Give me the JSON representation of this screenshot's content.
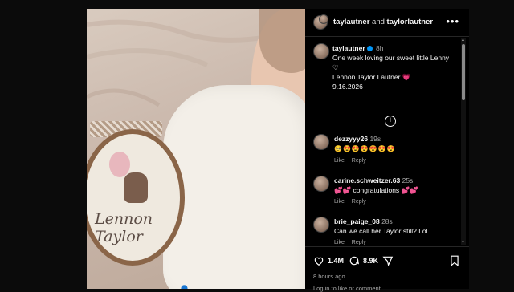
{
  "header": {
    "user1": "taylautner",
    "conjunction": "and",
    "user2": "taylorlautner",
    "more_icon": "more-horizontal-icon"
  },
  "photo": {
    "hoop_text_line1": "Lennon",
    "hoop_text_line2": "Taylor"
  },
  "caption": {
    "username": "taylautner",
    "time": "8h",
    "line1": "One week loving our sweet little Lenny",
    "heart1": "♡",
    "line2": "Lennon Taylor Lautner",
    "heart2": "💗",
    "line3": "9.16.2026"
  },
  "comments": [
    {
      "username": "dezzyyy26",
      "time": "19s",
      "text": "🥺😍😍😍😍😍😍",
      "like": "Like",
      "reply": "Reply"
    },
    {
      "username": "carine.schweitzer.63",
      "time": "25s",
      "text": "💕💕 congratulations 💕💕",
      "like": "Like",
      "reply": "Reply"
    },
    {
      "username": "brie_paige_08",
      "time": "28s",
      "text": "Can we call her Taylor still? Lol",
      "like": "Like",
      "reply": "Reply"
    }
  ],
  "actions": {
    "likes": "1.4M",
    "comments": "8.9K"
  },
  "footer": {
    "time_ago": "8 hours ago",
    "login_prompt": "Log in to like or comment."
  }
}
